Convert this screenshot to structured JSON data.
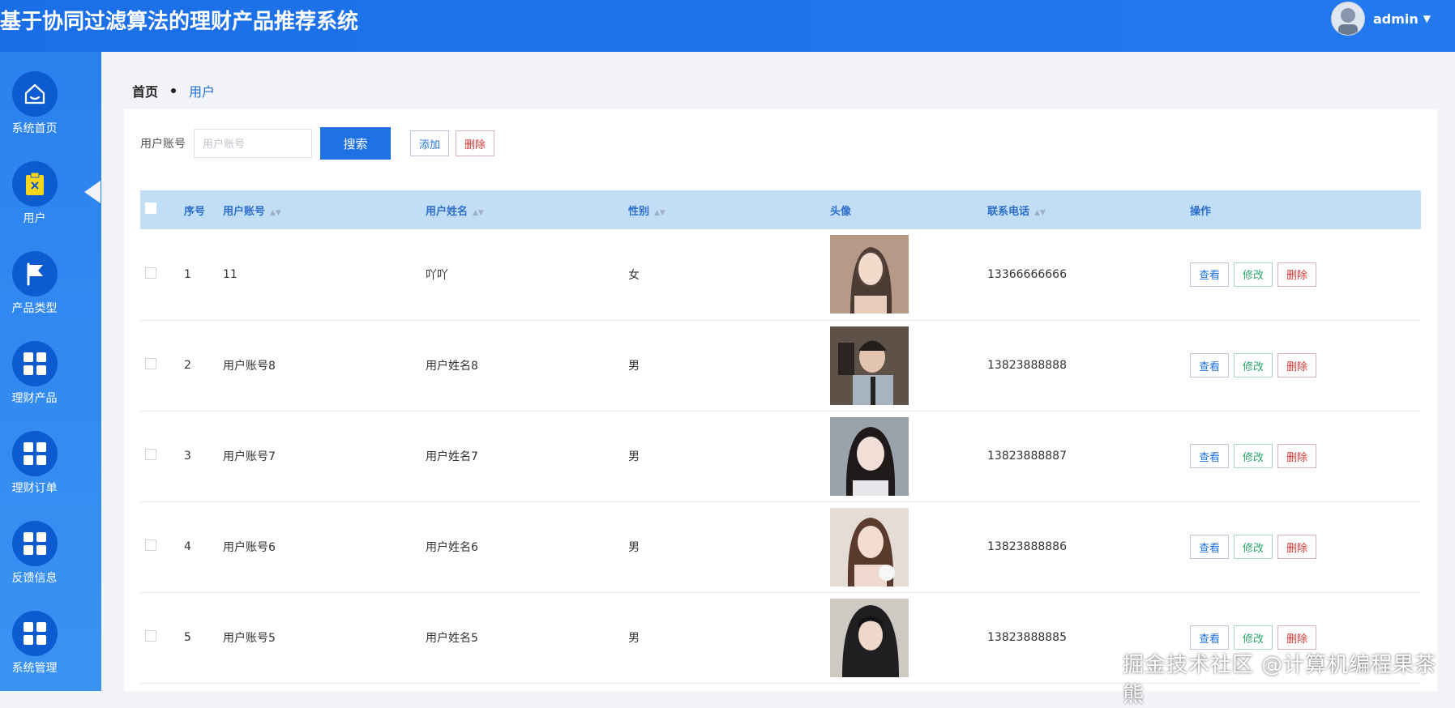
{
  "header": {
    "title": "基于协同过滤算法的理财产品推荐系统",
    "username": "admin"
  },
  "sidebar": {
    "items": [
      {
        "label": "系统首页",
        "icon": "home-icon"
      },
      {
        "label": "用户",
        "icon": "clipboard-icon"
      },
      {
        "label": "产品类型",
        "icon": "flag-icon"
      },
      {
        "label": "理财产品",
        "icon": "grid-icon"
      },
      {
        "label": "理财订单",
        "icon": "grid-icon"
      },
      {
        "label": "反馈信息",
        "icon": "grid-icon"
      },
      {
        "label": "系统管理",
        "icon": "grid-icon"
      }
    ],
    "active_index": 1
  },
  "breadcrumb": {
    "home": "首页",
    "current": "用户"
  },
  "search": {
    "label": "用户账号",
    "placeholder": "用户账号",
    "search_button": "搜索",
    "add_button": "添加",
    "delete_button": "删除"
  },
  "table": {
    "headers": {
      "index": "序号",
      "account": "用户账号",
      "name": "用户姓名",
      "gender": "性别",
      "avatar": "头像",
      "phone": "联系电话",
      "actions": "操作"
    },
    "action_labels": {
      "view": "查看",
      "edit": "修改",
      "delete": "删除"
    },
    "rows": [
      {
        "index": "1",
        "account": "11",
        "name": "吖吖",
        "gender": "女",
        "phone": "13366666666"
      },
      {
        "index": "2",
        "account": "用户账号8",
        "name": "用户姓名8",
        "gender": "男",
        "phone": "13823888888"
      },
      {
        "index": "3",
        "account": "用户账号7",
        "name": "用户姓名7",
        "gender": "男",
        "phone": "13823888887"
      },
      {
        "index": "4",
        "account": "用户账号6",
        "name": "用户姓名6",
        "gender": "男",
        "phone": "13823888886"
      },
      {
        "index": "5",
        "account": "用户账号5",
        "name": "用户姓名5",
        "gender": "男",
        "phone": "13823888885"
      }
    ]
  },
  "watermark": "掘金技术社区 @计算机编程果茶熊",
  "colors": {
    "header_bg": "#1a6fe6",
    "sidebar_bg": "#2a81ee",
    "primary": "#1e72e3",
    "table_header_bg": "#c2ddf6",
    "danger": "#dd3333",
    "success": "#2aa86b"
  }
}
